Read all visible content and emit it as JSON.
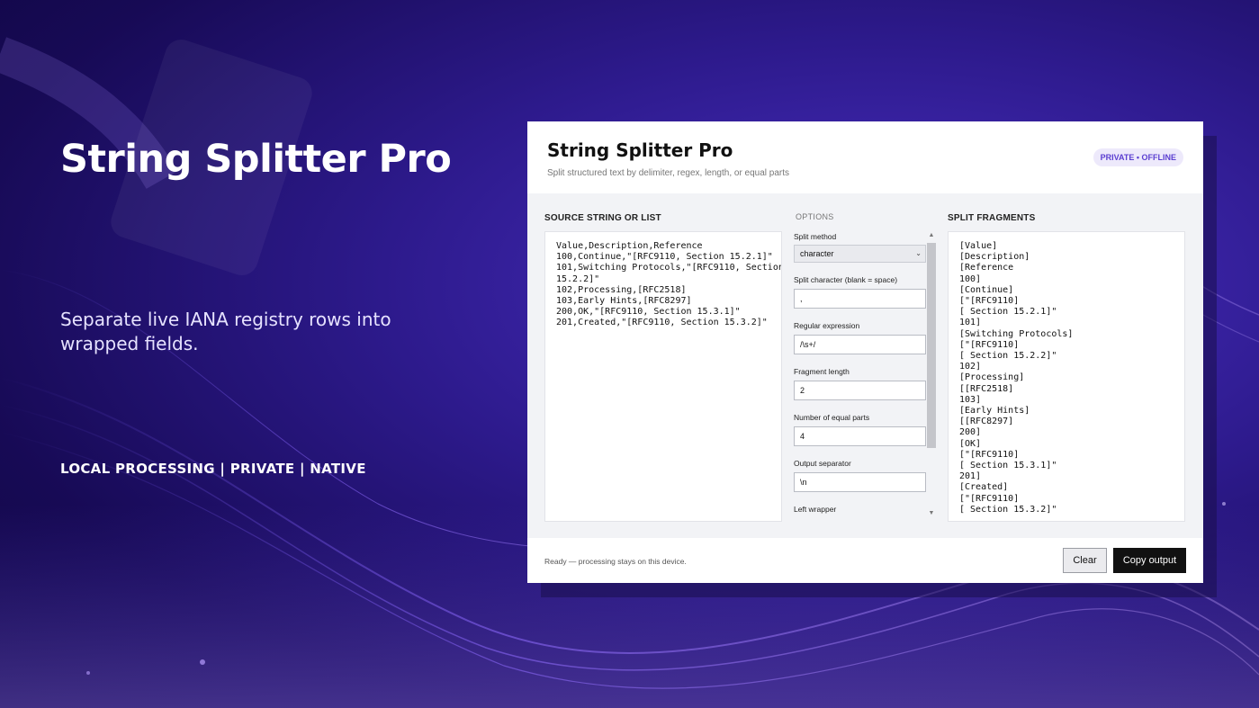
{
  "hero": {
    "title": "String Splitter Pro",
    "subtitle": "Separate live IANA registry rows into wrapped fields.",
    "tags": "LOCAL PROCESSING  |  PRIVATE  |  NATIVE"
  },
  "app": {
    "title": "String Splitter Pro",
    "subtitle": "Split structured text by delimiter, regex, length, or equal parts",
    "badge": "PRIVATE • OFFLINE",
    "source": {
      "label": "SOURCE STRING OR LIST",
      "value": "Value,Description,Reference\n100,Continue,\"[RFC9110, Section 15.2.1]\"\n101,Switching Protocols,\"[RFC9110, Section\n15.2.2]\"\n102,Processing,[RFC2518]\n103,Early Hints,[RFC8297]\n200,OK,\"[RFC9110, Section 15.3.1]\"\n201,Created,\"[RFC9110, Section 15.3.2]\""
    },
    "options": {
      "label": "OPTIONS",
      "split_method": {
        "label": "Split method",
        "value": "character"
      },
      "split_character": {
        "label": "Split character (blank = space)",
        "value": ","
      },
      "regex": {
        "label": "Regular expression",
        "value": "/\\s+/"
      },
      "fragment_length": {
        "label": "Fragment length",
        "value": "2"
      },
      "equal_parts": {
        "label": "Number of equal parts",
        "value": "4"
      },
      "output_separator": {
        "label": "Output separator",
        "value": "\\n"
      },
      "left_wrapper": {
        "label": "Left wrapper"
      }
    },
    "output": {
      "label": "SPLIT FRAGMENTS",
      "value": "[Value]\n[Description]\n[Reference\n100]\n[Continue]\n[\"[RFC9110]\n[ Section 15.2.1]\"\n101]\n[Switching Protocols]\n[\"[RFC9110]\n[ Section 15.2.2]\"\n102]\n[Processing]\n[[RFC2518]\n103]\n[Early Hints]\n[[RFC8297]\n200]\n[OK]\n[\"[RFC9110]\n[ Section 15.3.1]\"\n201]\n[Created]\n[\"[RFC9110]\n[ Section 15.3.2]\""
    },
    "footer": {
      "status": "Ready — processing stays on this device.",
      "clear_label": "Clear",
      "copy_label": "Copy output"
    }
  },
  "colors": {
    "accent": "#5b3fd1",
    "badge_bg": "#ede9fb",
    "copy_button": "#111111"
  }
}
